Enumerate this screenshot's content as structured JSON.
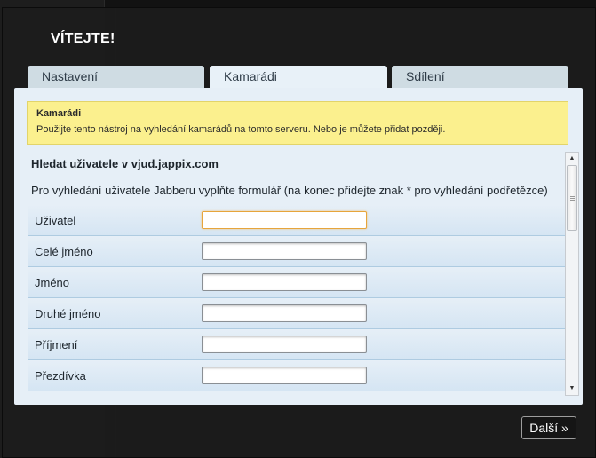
{
  "modal": {
    "title": "VÍTEJTE!",
    "tabs": [
      {
        "label": "Nastavení",
        "active": false
      },
      {
        "label": "Kamarádi",
        "active": true
      },
      {
        "label": "Sdílení",
        "active": false
      }
    ],
    "info": {
      "title": "Kamarádi",
      "text": "Použijte tento nástroj na vyhledání kamarádů na tomto serveru. Nebo je můžete přidat později."
    },
    "search": {
      "section_title": "Hledat uživatele v vjud.jappix.com",
      "description": "Pro vyhledání uživatele Jabberu vyplňte formulář (na konec přidejte znak * pro vyhledání podřetězce)",
      "fields": [
        {
          "label": "Uživatel",
          "value": ""
        },
        {
          "label": "Celé jméno",
          "value": ""
        },
        {
          "label": "Jméno",
          "value": ""
        },
        {
          "label": "Druhé jméno",
          "value": ""
        },
        {
          "label": "Příjmení",
          "value": ""
        },
        {
          "label": "Přezdívka",
          "value": ""
        }
      ]
    },
    "next_label": "Další »"
  },
  "colors": {
    "accent_focus": "#e7a53b",
    "info_bg": "#fbf08e",
    "panel_bg": "#e6eff7",
    "overlay_bg": "#1c1c1c"
  }
}
